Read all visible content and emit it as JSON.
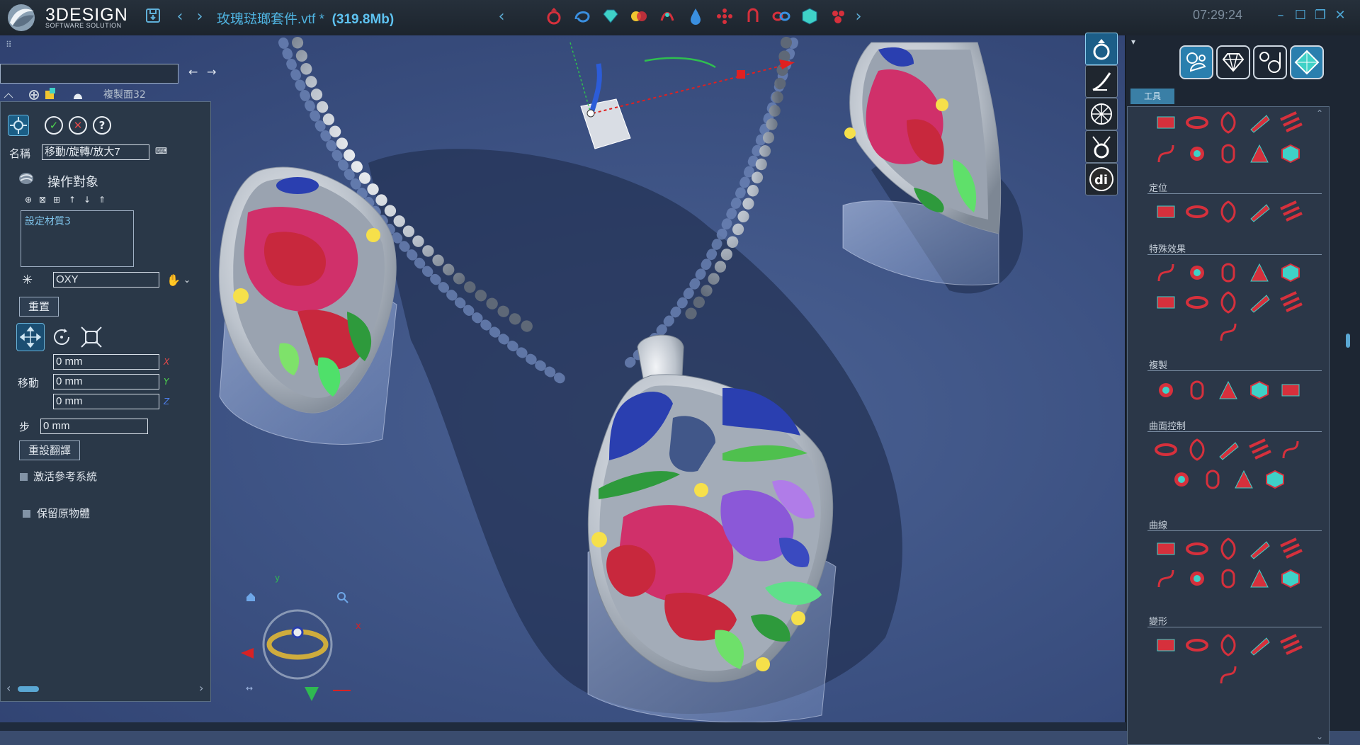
{
  "app": {
    "brand": "3DESIGN",
    "brand_sub": "SOFTWARE SOLUTION",
    "doc_title": "玫瑰琺瑯套件.vtf *",
    "doc_size": "(319.8Mb)",
    "clock": "07:29:24"
  },
  "tree": {
    "item_label": "複製面32"
  },
  "panel": {
    "name_label": "名稱",
    "name_value": "移動/旋轉/放大7",
    "objects_label": "操作對象",
    "object_item": "設定材質3",
    "plane_value": "OXY",
    "reset_label": "重置",
    "move_label": "移動",
    "move_x": "0 mm",
    "move_y": "0 mm",
    "move_z": "0 mm",
    "axis_x": "X",
    "axis_y": "Y",
    "axis_z": "Z",
    "step_label": "步",
    "step_value": "0 mm",
    "reset_flip_label": "重設翻譯",
    "activate_ref_label": "激活參考系統",
    "keep_original_label": "保留原物體"
  },
  "right": {
    "tab_label": "工具",
    "sections": [
      "定位",
      "特殊效果",
      "複製",
      "曲面控制",
      "曲線",
      "變形"
    ]
  },
  "colors": {
    "accent": "#4fb3e0",
    "icon_red": "#d6303c",
    "icon_teal": "#3fd1c7"
  }
}
